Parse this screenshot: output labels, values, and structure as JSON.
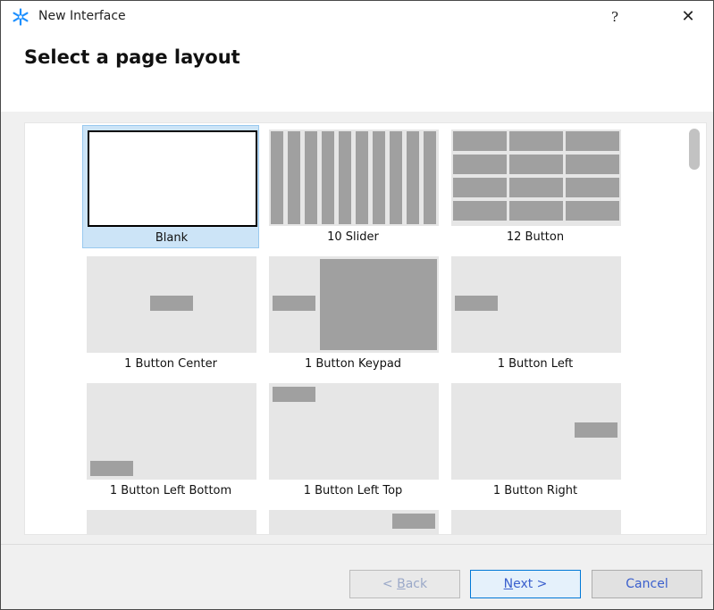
{
  "window": {
    "title": "New Interface",
    "help_label": "?",
    "close_label": "✕",
    "app_icon": "asterisk-icon",
    "accent": "#1e90ff"
  },
  "heading": "Select a page layout",
  "layouts": [
    {
      "label": "Blank",
      "selected": true
    },
    {
      "label": "10 Slider"
    },
    {
      "label": "12 Button"
    },
    {
      "label": "1 Button Center"
    },
    {
      "label": "1 Button Keypad"
    },
    {
      "label": "1 Button Left"
    },
    {
      "label": "1 Button Left Bottom"
    },
    {
      "label": "1 Button Left Top"
    },
    {
      "label": "1 Button Right"
    }
  ],
  "buttons": {
    "back": {
      "prefix": "< ",
      "mnemonic": "B",
      "rest": "ack"
    },
    "next": {
      "mnemonic": "N",
      "rest": "ext >"
    },
    "cancel": "Cancel"
  },
  "colors": {
    "selection": "#cce4f7",
    "thumb_bg": "#e6e6e6",
    "thumb_bar": "#a0a0a0"
  }
}
